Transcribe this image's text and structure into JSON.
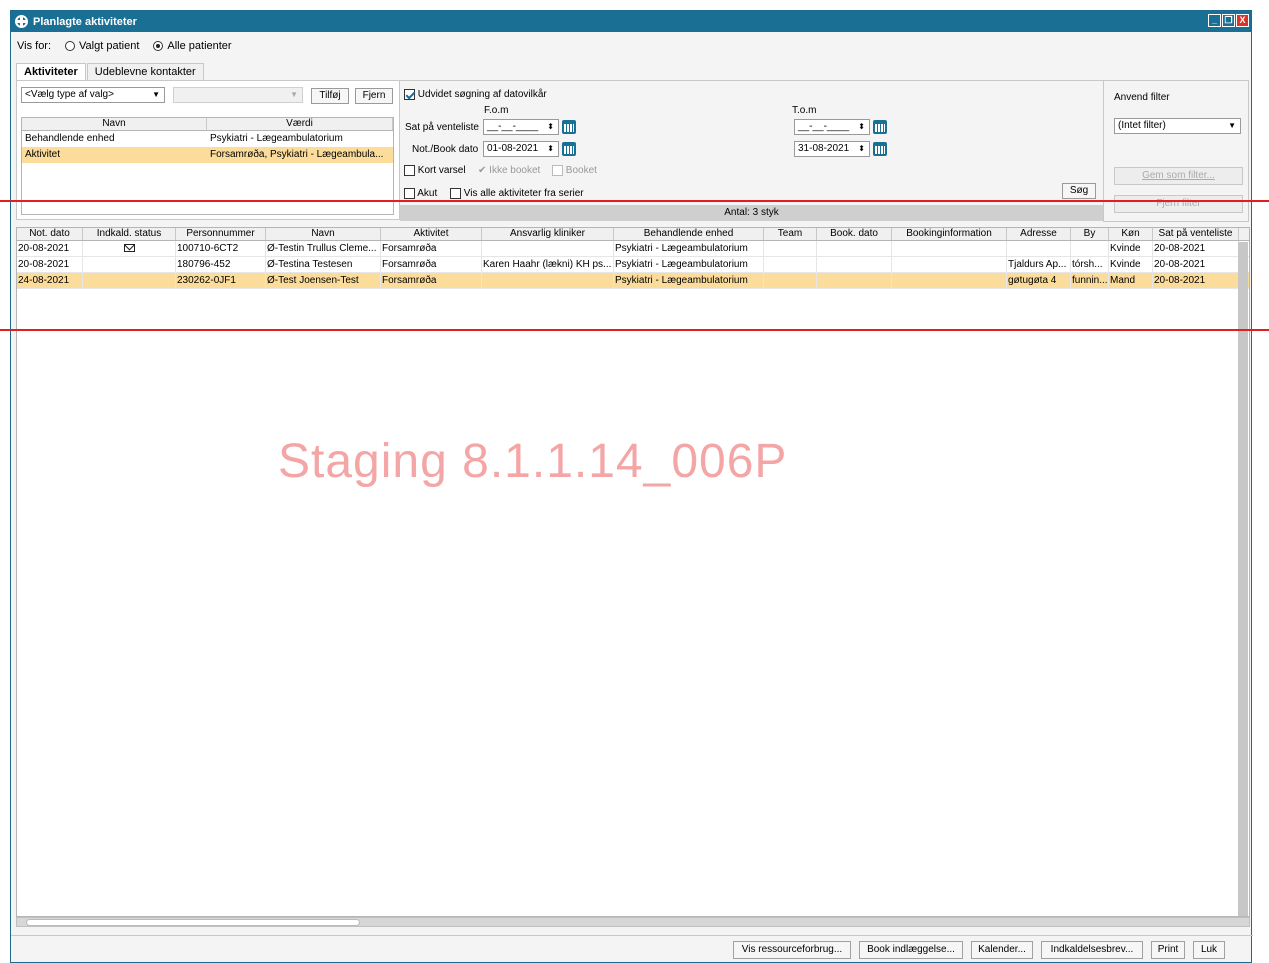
{
  "window": {
    "title": "Planlagte aktiviteter",
    "controls": [
      "_",
      "❐",
      "X"
    ]
  },
  "visfor": {
    "label": "Vis for:",
    "options": [
      "Valgt patient",
      "Alle patienter"
    ],
    "selected": 1
  },
  "tabs": [
    "Aktiviteter",
    "Udeblevne kontakter"
  ],
  "left": {
    "type_select": "<Vælg type af valg>",
    "add_label": "Tilføj",
    "remove_label": "Fjern",
    "headers": [
      "Navn",
      "Værdi"
    ],
    "rows": [
      {
        "navn": "Behandlende enhed",
        "vaerdi": "Psykiatri - Lægeambulatorium"
      },
      {
        "navn": "Aktivitet",
        "vaerdi": "Forsamrøða, Psykiatri - Lægeambula..."
      }
    ]
  },
  "mid": {
    "udvidet_label": "Udvidet søgning af datovilkår",
    "fom_label": "F.o.m",
    "tom_label": "T.o.m",
    "sat_label": "Sat på venteliste",
    "sat_fom": "__-__-____",
    "sat_tom": "__-__-____",
    "not_label": "Not./Book dato",
    "not_fom": "01-08-2021",
    "not_tom": "31-08-2021",
    "kort_varsel": "Kort varsel",
    "ikke_booket": "Ikke booket",
    "booket": "Booket",
    "akut": "Akut",
    "vis_alle": "Vis alle aktiviteter fra serier",
    "sog_label": "Søg",
    "antal": "Antal: 3 styk"
  },
  "right": {
    "title": "Anvend filter",
    "filter_value": "(Intet filter)",
    "gem_label": "Gem som filter...",
    "fjern_label": "Fjern filter"
  },
  "grid": {
    "headers": [
      "Not. dato",
      "Indkald. status",
      "Personnummer",
      "Navn",
      "Aktivitet",
      "Ansvarlig kliniker",
      "Behandlende enhed",
      "Team",
      "Book. dato",
      "Bookinginformation",
      "Adresse",
      "By",
      "Køn",
      "Sat på venteliste"
    ],
    "rows": [
      [
        "20-08-2021",
        "",
        "100710-6CT2",
        "Ø-Testin Trullus Cleme...",
        "Forsamrøða",
        "",
        "Psykiatri - Lægeambulatorium",
        "",
        "",
        "",
        "",
        "",
        "Kvinde",
        "20-08-2021"
      ],
      [
        "20-08-2021",
        "",
        "180796-452",
        "Ø-Testina Testesen",
        "Forsamrøða",
        "Karen Haahr (lækni) KH ps...",
        "Psykiatri - Lægeambulatorium",
        "",
        "",
        "",
        "Tjaldurs Ap...",
        "tórsh...",
        "Kvinde",
        "20-08-2021"
      ],
      [
        "24-08-2021",
        "",
        "230262-0JF1",
        "Ø-Test Joensen-Test",
        "Forsamrøða",
        "",
        "Psykiatri - Lægeambulatorium",
        "",
        "",
        "",
        "gøtugøta 4",
        "funnin...",
        "Mand",
        "20-08-2021"
      ]
    ]
  },
  "watermark": "Staging 8.1.1.14_006P",
  "bottom_buttons": [
    "Vis ressourceforbrug...",
    "Book indlæggelse...",
    "Kalender...",
    "Indkaldelsesbrev...",
    "Print",
    "Luk"
  ]
}
